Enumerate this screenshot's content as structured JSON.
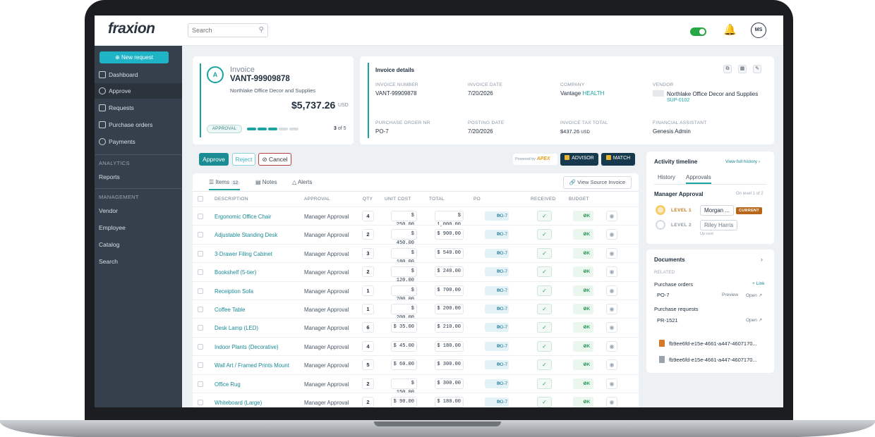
{
  "app": {
    "logo": "fraxion"
  },
  "search": {
    "placeholder": "Search"
  },
  "user": {
    "initials": "MS"
  },
  "sidebar": {
    "new_request": "New request",
    "items": [
      {
        "label": "Dashboard"
      },
      {
        "label": "Approve"
      },
      {
        "label": "Requests"
      },
      {
        "label": "Purchase orders"
      },
      {
        "label": "Payments"
      }
    ],
    "analytics_label": "ANALYTICS",
    "analytics_items": [
      {
        "label": "Reports"
      }
    ],
    "management_label": "MANAGEMENT",
    "management_items": [
      {
        "label": "Vendor"
      },
      {
        "label": "Employee"
      },
      {
        "label": "Catalog"
      },
      {
        "label": "Search"
      }
    ]
  },
  "invoice": {
    "badge": "A",
    "title": "Invoice",
    "number": "VANT-99909878",
    "vendor": "Northlake Office Decor and Supplies",
    "amount": "$5,737.26",
    "currency": "USD",
    "status": "APPROVAL",
    "step_current": "3",
    "step_total": "of 5",
    "progress": {
      "completed": 3,
      "total": 5
    }
  },
  "details": {
    "title": "Invoice details",
    "fields": [
      {
        "label": "INVOICE NUMBER",
        "value": "VANT-99909878"
      },
      {
        "label": "INVOICE DATE",
        "value": "7/20/2026"
      },
      {
        "label": "COMPANY",
        "value": "Vantage",
        "extra": "HEALTH"
      },
      {
        "label": "VENDOR",
        "value": "Northlake Office Decor and Supplies",
        "extra": "SUP-0102"
      },
      {
        "label": "PURCHASE ORDER NR",
        "value": "PO-7"
      },
      {
        "label": "POSTING DATE",
        "value": "7/20/2026"
      },
      {
        "label": "INVOICE TAX TOTAL",
        "value": "$437.26",
        "extra": "USD"
      },
      {
        "label": "FINANCIAL ASSISTANT",
        "value": "Genesis Admin"
      }
    ]
  },
  "actions": {
    "approve": "Approve",
    "reject": "Reject",
    "cancel": "Cancel",
    "powered_by": "Powered by",
    "apex": "APEX",
    "advisor": "ADVISOR",
    "match": "MATCH"
  },
  "table": {
    "tabs": [
      {
        "label": "Items",
        "count": "12"
      },
      {
        "label": "Notes"
      },
      {
        "label": "Alerts"
      }
    ],
    "view_source": "View Source Invoice",
    "columns": [
      "DESCRIPTION",
      "APPROVAL",
      "QTY",
      "UNIT COST",
      "TOTAL",
      "PO",
      "RECEIVED",
      "BUDGET"
    ],
    "rows": [
      {
        "desc": "Ergonomic Office Chair",
        "approval": "Manager Approval",
        "qty": "4",
        "unit": "$ 250.00",
        "total": "$ 1,000.00",
        "po": "PO-7",
        "budget": "OK"
      },
      {
        "desc": "Adjustable Standing Desk",
        "approval": "Manager Approval",
        "qty": "2",
        "unit": "$ 450.00",
        "total": "$ 900.00",
        "po": "PO-7",
        "budget": "OK"
      },
      {
        "desc": "3-Drawer Filing Cabinet",
        "approval": "Manager Approval",
        "qty": "3",
        "unit": "$ 180.00",
        "total": "$ 540.00",
        "po": "PO-7",
        "budget": "OK"
      },
      {
        "desc": "Bookshelf (5-tier)",
        "approval": "Manager Approval",
        "qty": "2",
        "unit": "$ 120.00",
        "total": "$ 240.00",
        "po": "PO-7",
        "budget": "OK"
      },
      {
        "desc": "Receiption Sofa",
        "approval": "Manager Approval",
        "qty": "1",
        "unit": "$ 700.00",
        "total": "$ 700.00",
        "po": "PO-7",
        "budget": "OK"
      },
      {
        "desc": "Coffee Table",
        "approval": "Manager Approval",
        "qty": "1",
        "unit": "$ 200.00",
        "total": "$ 200.00",
        "po": "PO-7",
        "budget": "OK"
      },
      {
        "desc": "Desk Lamp (LED)",
        "approval": "Manager Approval",
        "qty": "6",
        "unit": "$ 35.00",
        "total": "$ 210.00",
        "po": "PO-7",
        "budget": "OK"
      },
      {
        "desc": "Indoor Plants (Decorative)",
        "approval": "Manager Approval",
        "qty": "4",
        "unit": "$ 45.00",
        "total": "$ 180.00",
        "po": "PO-7",
        "budget": "OK"
      },
      {
        "desc": "Wall Art / Framed Prints Mount",
        "approval": "Manager Approval",
        "qty": "5",
        "unit": "$ 60.00",
        "total": "$ 300.00",
        "po": "PO-7",
        "budget": "OK"
      },
      {
        "desc": "Office Rug",
        "approval": "Manager Approval",
        "qty": "2",
        "unit": "$ 150.00",
        "total": "$ 300.00",
        "po": "PO-7",
        "budget": "OK"
      },
      {
        "desc": "Whiteboard (Large)",
        "approval": "Manager Approval",
        "qty": "2",
        "unit": "$ 90.00",
        "total": "$ 180.00",
        "po": "PO-7",
        "budget": "OK"
      }
    ]
  },
  "activity": {
    "title": "Activity timeline",
    "view_full": "View full history",
    "tabs": [
      "History",
      "Approvals"
    ],
    "step": "Manager Approval",
    "on_level": "On level 1 of 2",
    "levels": [
      {
        "label": "LEVEL 1",
        "person": "Morgan ...",
        "status": "CURRENT"
      },
      {
        "label": "LEVEL 2",
        "person": "Riley Harris",
        "note": "Up next"
      }
    ]
  },
  "documents": {
    "title": "Documents",
    "related": "RELATED",
    "po_label": "Purchase orders",
    "link": "Link",
    "po_item": "PO-7",
    "preview": "Preview",
    "open": "Open",
    "pr_label": "Purchase requests",
    "pr_item": "PR-1521",
    "files": [
      "fb9ee6fd-e15e-4661-a447-4607170...",
      "fb9ee6fd-e15e-4661-a447-4607170..."
    ]
  },
  "colors": {
    "accent": "#1aa3a0",
    "sidebar": "#36404d",
    "brand_dark": "#17394d",
    "current": "#b8661a"
  }
}
